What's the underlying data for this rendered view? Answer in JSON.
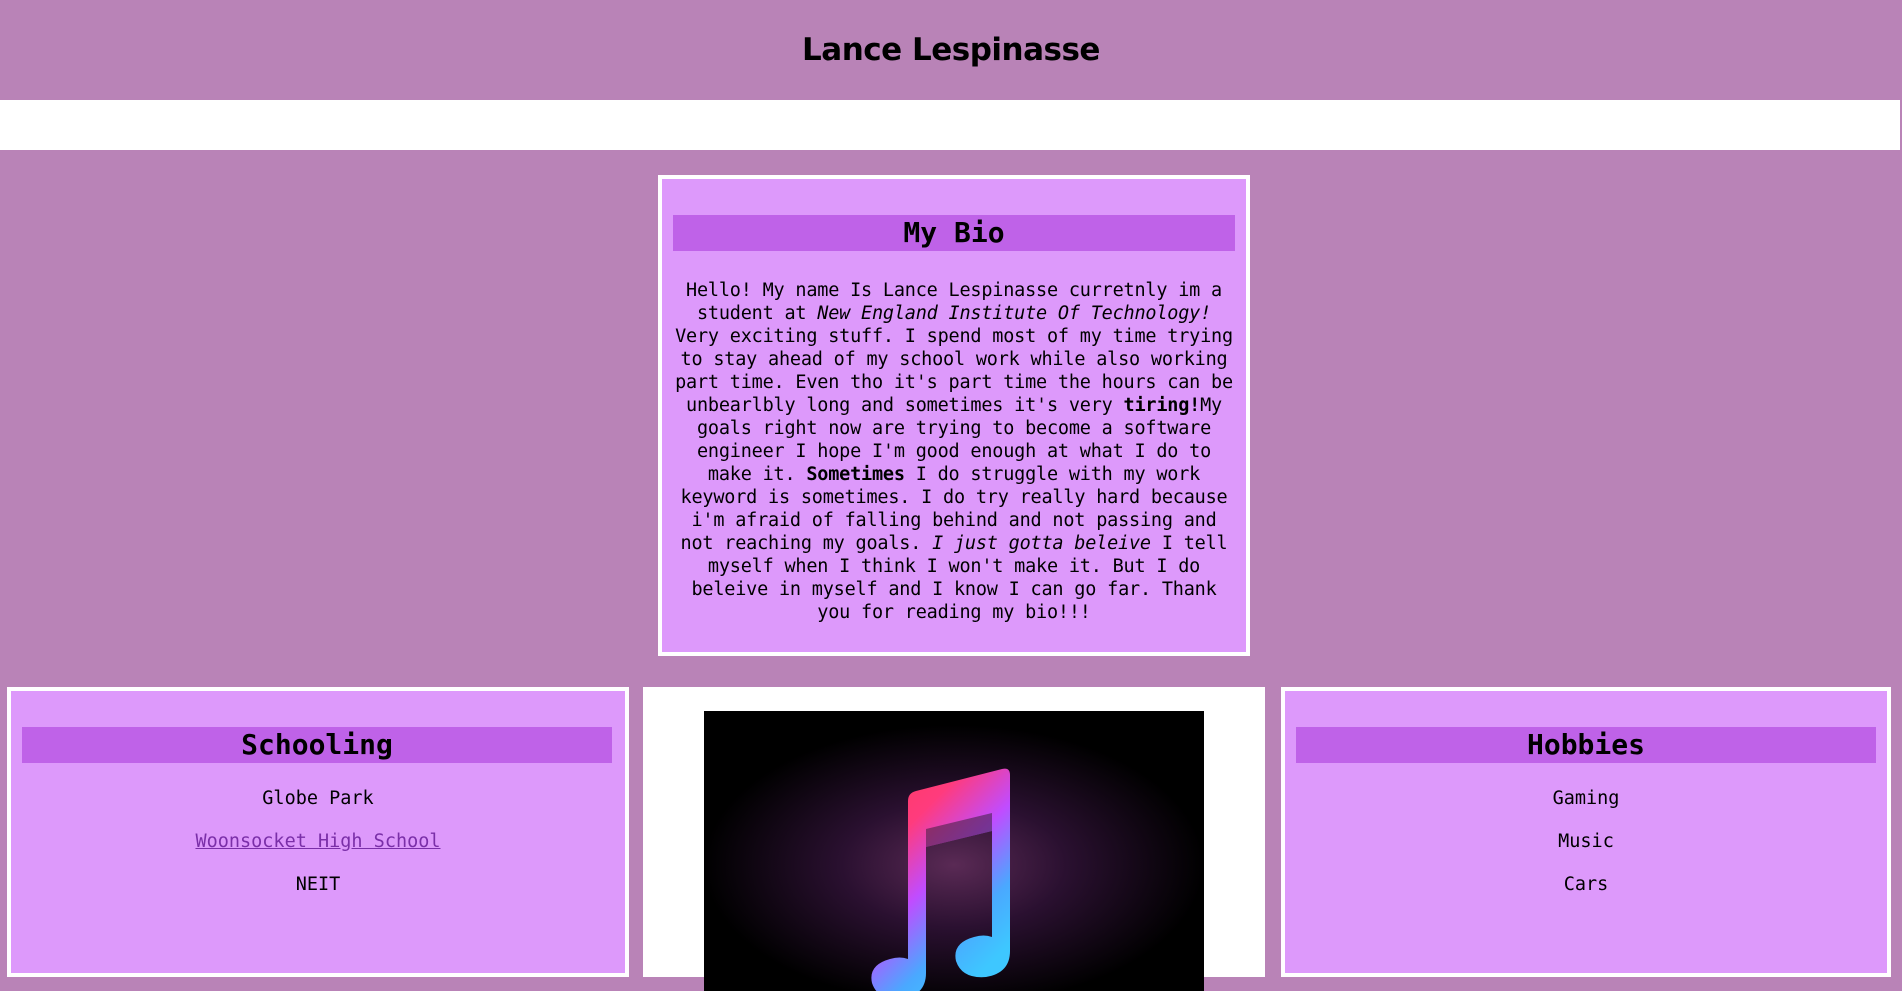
{
  "header": {
    "title": "Lance Lespinasse"
  },
  "bio": {
    "heading": "My Bio",
    "segments": [
      {
        "text": "Hello! My name Is Lance Lespinasse curretnly im a student at ",
        "style": "normal"
      },
      {
        "text": "New England Institute Of Technology!",
        "style": "italic"
      },
      {
        "text": " Very exciting stuff. I spend most of my time trying to stay ahead of my school work while also working part time. Even tho it's part time the hours can be unbearlbly long and sometimes it's very ",
        "style": "normal"
      },
      {
        "text": "tiring!",
        "style": "bold"
      },
      {
        "text": "My goals right now are trying to become a software engineer I hope I'm good enough at what I do to make it. ",
        "style": "normal"
      },
      {
        "text": "Sometimes",
        "style": "bold"
      },
      {
        "text": " I do struggle with my work keyword is sometimes. I do try really hard because i'm afraid of falling behind and not passing and not reaching my goals. ",
        "style": "normal"
      },
      {
        "text": "I just gotta beleive",
        "style": "italic"
      },
      {
        "text": " I tell myself when I think I won't make it. But I do beleive in myself and I know I can go far. Thank you for reading my bio!!!",
        "style": "normal"
      }
    ]
  },
  "schooling": {
    "heading": "Schooling",
    "items": [
      "Globe Park",
      "Woonsocket High School",
      "NEIT"
    ]
  },
  "hobbies": {
    "heading": "Hobbies",
    "items": [
      "Gaming",
      "Music",
      "Cars"
    ]
  },
  "music_image": {
    "icon": "music-note-icon"
  }
}
